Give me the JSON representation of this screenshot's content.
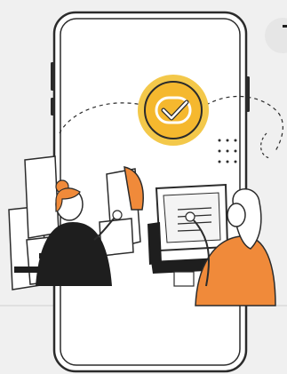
{
  "illustration": {
    "colors": {
      "background": "#f0f0f0",
      "phone_outline": "#2b2b2b",
      "screen": "#ffffff",
      "accent": "#f08a3a",
      "accent_light": "#f7a15a",
      "check_badge": "#f5b82e",
      "check_badge_ring": "#f3c84a",
      "dark": "#1e1e1e"
    },
    "icons": [
      "smartphone-icon",
      "check-badge-icon",
      "dotted-grid-icon",
      "dashed-path-icon",
      "laptop-icon",
      "person-with-screens-icon",
      "person-at-laptop-icon"
    ]
  }
}
